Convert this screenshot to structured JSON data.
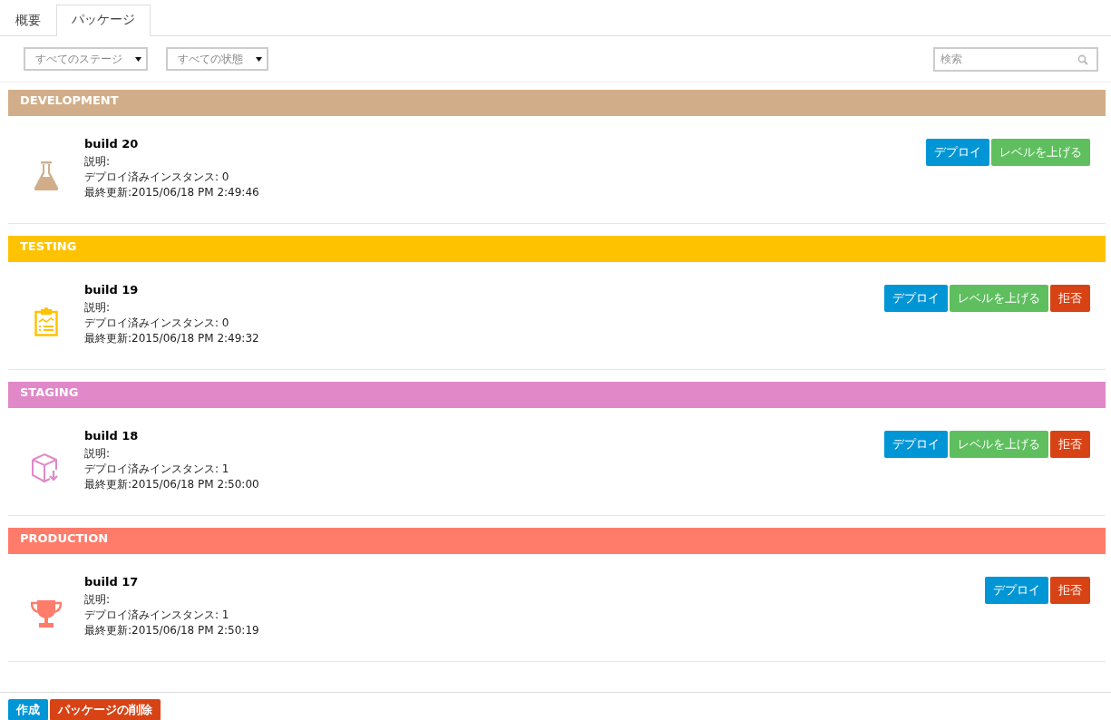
{
  "tabs": [
    {
      "label": "概要",
      "selected": false
    },
    {
      "label": "パッケージ",
      "selected": true
    }
  ],
  "filters": [
    {
      "value": "すべてのステージ"
    },
    {
      "value": "すべての状態"
    }
  ],
  "search": {
    "placeholder": "検索"
  },
  "stages": [
    {
      "name": "DEVELOPMENT",
      "color": "#d1ae89",
      "kind": "flask",
      "build": "build 20",
      "description": "説明:",
      "instances": "デプロイ済みインスタンス: 0",
      "updated": "最終更新:2015/06/18 PM 2:49:46",
      "actions": [
        {
          "kind": "deploy",
          "label": "デプロイ"
        },
        {
          "kind": "promote",
          "label": "レベルを上げる"
        }
      ]
    },
    {
      "name": "TESTING",
      "color": "#ffc200",
      "kind": "clipboard",
      "build": "build 19",
      "description": "説明:",
      "instances": "デプロイ済みインスタンス: 0",
      "updated": "最終更新:2015/06/18 PM 2:49:32",
      "actions": [
        {
          "kind": "deploy",
          "label": "デプロイ"
        },
        {
          "kind": "promote",
          "label": "レベルを上げる"
        },
        {
          "kind": "reject",
          "label": "拒否"
        }
      ]
    },
    {
      "name": "STAGING",
      "color": "#e088c8",
      "kind": "box",
      "build": "build 18",
      "description": "説明:",
      "instances": "デプロイ済みインスタンス: 1",
      "updated": "最終更新:2015/06/18 PM 2:50:00",
      "actions": [
        {
          "kind": "deploy",
          "label": "デプロイ"
        },
        {
          "kind": "promote",
          "label": "レベルを上げる"
        },
        {
          "kind": "reject",
          "label": "拒否"
        }
      ]
    },
    {
      "name": "PRODUCTION",
      "color": "#ff7c6b",
      "kind": "trophy",
      "build": "build 17",
      "description": "説明:",
      "instances": "デプロイ済みインスタンス: 1",
      "updated": "最終更新:2015/06/18 PM 2:50:19",
      "actions": [
        {
          "kind": "deploy",
          "label": "デプロイ"
        },
        {
          "kind": "reject",
          "label": "拒否"
        }
      ]
    }
  ],
  "footer_buttons": [
    {
      "kind": "create",
      "label": "作成"
    },
    {
      "kind": "delete",
      "label": "パッケージの削除"
    }
  ]
}
